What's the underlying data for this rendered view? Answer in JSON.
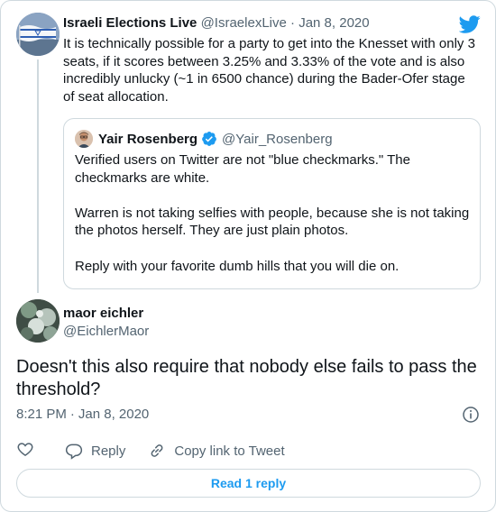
{
  "parent_tweet": {
    "display_name": "Israeli Elections Live",
    "handle": "@IsraelexLive",
    "separator": "·",
    "date": "Jan 8, 2020",
    "text": "It is technically possible for a party to get into the Knesset with only 3 seats, if it scores between 3.25% and 3.33% of the vote and is also incredibly unlucky (~1 in 6500 chance) during the Bader-Ofer stage of seat allocation."
  },
  "quoted_tweet": {
    "display_name": "Yair Rosenberg",
    "handle": "@Yair_Rosenberg",
    "text": "Verified users on Twitter are not \"blue checkmarks.\" The checkmarks are white.\n\nWarren is not taking selfies with people, because she is not taking the photos herself. They are just plain photos.\n\nReply with your favorite dumb hills that you will die on."
  },
  "main_tweet": {
    "display_name": "maor eichler",
    "handle": "@EichlerMaor",
    "text": "Doesn't this also require that nobody else fails to pass the threshold?",
    "time": "8:21 PM",
    "separator": "·",
    "date": "Jan 8, 2020"
  },
  "actions": {
    "reply_label": "Reply",
    "copy_link_label": "Copy link to Tweet"
  },
  "read_replies_label": "Read 1 reply",
  "icons": {
    "logo": "twitter-bird-icon",
    "verified": "verified-badge-icon",
    "info": "info-icon",
    "like": "heart-icon",
    "reply": "speech-bubble-icon",
    "copy": "link-icon"
  },
  "colors": {
    "brand": "#1d9bf0",
    "text": "#0f1419",
    "muted": "#536471",
    "border": "#cfd9de"
  }
}
